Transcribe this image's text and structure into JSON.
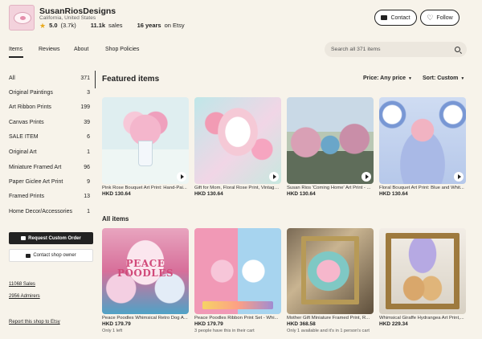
{
  "shop": {
    "name": "SusanRiosDesigns",
    "location": "California, United States",
    "rating": "5.0",
    "rating_count": "(3.7k)",
    "sales_count": "11.1k",
    "sales_label": "sales",
    "years": "16 years",
    "years_suffix": "on Etsy",
    "contact_label": "Contact",
    "follow_label": "Follow"
  },
  "nav": {
    "tabs": [
      "Items",
      "Reviews",
      "About",
      "Shop Policies"
    ],
    "active_tab": "Items",
    "search_placeholder": "Search all 371 items"
  },
  "sidebar": {
    "sections": [
      {
        "label": "All",
        "count": "371"
      },
      {
        "label": "Original Paintings",
        "count": "3"
      },
      {
        "label": "Art Ribbon Prints",
        "count": "199"
      },
      {
        "label": "Canvas Prints",
        "count": "39"
      },
      {
        "label": "SALE ITEM",
        "count": "6"
      },
      {
        "label": "Original Art",
        "count": "1"
      },
      {
        "label": "Miniature Framed Art",
        "count": "96"
      },
      {
        "label": "Paper Giclee Art Print",
        "count": "9"
      },
      {
        "label": "Framed Prints",
        "count": "13"
      },
      {
        "label": "Home Decor/Accessories",
        "count": "1"
      }
    ],
    "request_custom_order": "Request Custom Order",
    "contact_shop_owner": "Contact shop owner",
    "sales_link": "11068 Sales",
    "admirers_link": "2956 Admirers",
    "report_link": "Report this shop to Etsy"
  },
  "featured": {
    "title": "Featured items",
    "price_filter": "Price: Any price",
    "sort": "Sort: Custom",
    "items": [
      {
        "title": "Pink Rose Bouquet Art Print: Hand-Pai...",
        "price": "HKD 130.64"
      },
      {
        "title": "Gift for Mom, Floral Rose Print, Vintage ...",
        "price": "HKD 130.64"
      },
      {
        "title": "Susan Rios 'Coming Home' Art Print - ...",
        "price": "HKD 130.64"
      },
      {
        "title": "Floral Bouquet Art Print: Blue and Whit...",
        "price": "HKD 130.64"
      }
    ]
  },
  "all_items": {
    "title": "All items",
    "items": [
      {
        "title": "Peace Poodles Whimsical Retro Dog A...",
        "price": "HKD 179.79",
        "note": "Only 1 left",
        "thumb_text": "PEACE POODLES"
      },
      {
        "title": "Peace Poodles Ribbon Print Set - Whi...",
        "price": "HKD 179.79",
        "note": "3 people have this in their cart"
      },
      {
        "title": "Mother Gift Miniature Framed Print, R...",
        "price": "HKD 368.58",
        "note": "Only 1 available and it's in 1 person's cart"
      },
      {
        "title": "Whimsical Giraffe Hydrangea Art Print,...",
        "price": "HKD 229.34",
        "note": ""
      }
    ]
  }
}
